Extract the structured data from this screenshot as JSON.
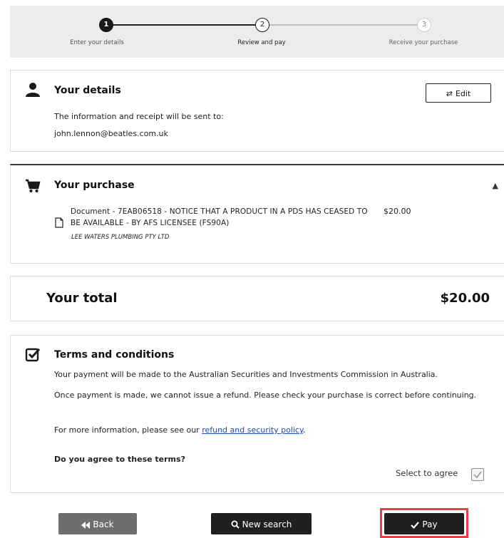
{
  "stepper": {
    "steps": [
      {
        "number": "1",
        "label": "Enter your details"
      },
      {
        "number": "2",
        "label": "Review and pay"
      },
      {
        "number": "3",
        "label": "Receive your purchase"
      }
    ]
  },
  "details": {
    "title": "Your details",
    "edit_label": "Edit",
    "info_text": "The information and receipt will be sent to:",
    "email": "john.lennon@beatles.com.uk"
  },
  "purchase": {
    "title": "Your purchase",
    "item": {
      "description": "Document - 7EAB06518 - NOTICE THAT A PRODUCT IN A PDS HAS CEASED TO BE AVAILABLE  - BY AFS LICENSEE (FS90A)",
      "company": "LEE WATERS PLUMBING PTY LTD",
      "price": "$20.00"
    }
  },
  "total": {
    "label": "Your total",
    "value": "$20.00"
  },
  "terms": {
    "title": "Terms and conditions",
    "p1": "Your payment will be made to the Australian Securities and Investments Commission in Australia.",
    "p2": "Once payment is made, we cannot issue a refund. Please check your purchase is correct before continuing.",
    "p3_prefix": "For more information, please see our ",
    "p3_link": "refund and security policy",
    "p3_suffix": ".",
    "question": "Do you agree to these terms?",
    "agree_label": "Select to agree"
  },
  "footer": {
    "back_label": "Back",
    "new_search_label": "New search",
    "pay_label": "Pay"
  },
  "colors": {
    "highlight": "#e0424a",
    "link": "#1a4fb5",
    "button_dark": "#1f1f1f",
    "button_gray": "#6e6e6e"
  }
}
